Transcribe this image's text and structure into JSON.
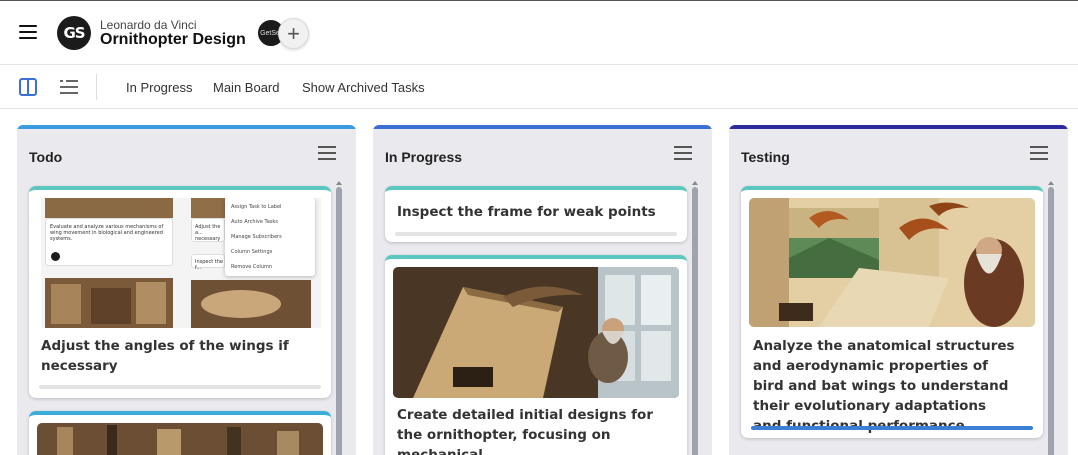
{
  "header": {
    "owner": "Leonardo da Vinci",
    "title": "Ornithopter Design",
    "logo_text": "GS",
    "member_avatar_text": "GetSet",
    "add_member_symbol": "+"
  },
  "toolbar": {
    "links": [
      "In Progress",
      "Main Board",
      "Show Archived Tasks"
    ],
    "accent": "#3b6fd4"
  },
  "columns": [
    {
      "title": "Todo",
      "accent": "#3a9be0",
      "cards": [
        {
          "title": "Adjust the angles of the wings if necessary",
          "thumbnail": {
            "panel_texts": [
              "Evaluate and analyze various mechanisms of wing movement in biological and engineered systems.",
              "Adjust the a... necessary",
              "Inspect the f..."
            ],
            "menu_items": [
              "Assign Task to Label",
              "Auto Archive Tasks",
              "Manage Subscribers",
              "Column Settings",
              "Remove Column"
            ]
          }
        }
      ]
    },
    {
      "title": "In Progress",
      "accent": "#3b6fd4",
      "cards": [
        {
          "title": "Inspect the frame for weak points"
        },
        {
          "title": "Create detailed initial designs for the ornithopter, focusing on mechanical"
        }
      ]
    },
    {
      "title": "Testing",
      "accent": "#2d2a9e",
      "cards": [
        {
          "title": "Analyze the anatomical structures and aerodynamic properties of bird and bat wings to understand their evolutionary adaptations and functional performance.",
          "progress": 1.0
        }
      ]
    }
  ]
}
